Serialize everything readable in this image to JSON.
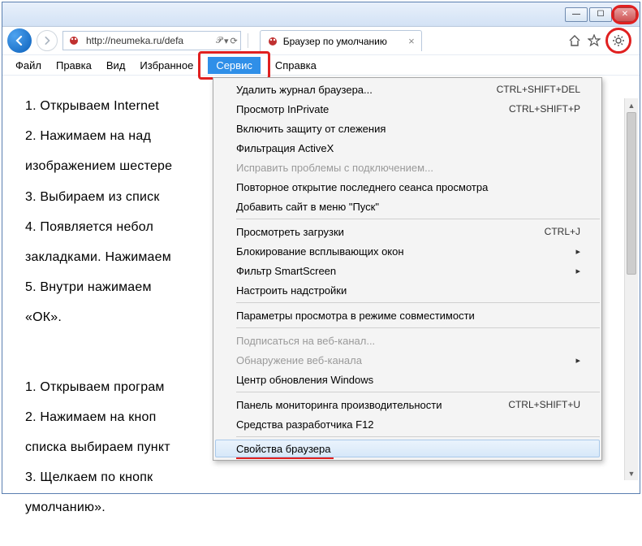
{
  "titlebar": {
    "minimize": "—",
    "maximize": "☐"
  },
  "nav": {
    "url": "http://neumeka.ru/defa",
    "search_hint": "𝒫",
    "refresh": "⟳"
  },
  "tab": {
    "title": "Браузер по умолчанию"
  },
  "menubar": {
    "file": "Файл",
    "edit": "Правка",
    "view": "Вид",
    "favorites": "Избранное",
    "tools": "Сервис",
    "help": "Справка"
  },
  "content": {
    "l1": "1.  Открываем Internet",
    "l2": "2.  Нажимаем  на  над",
    "l3": "изображением шестере",
    "l4": "3.  Выбираем из списк",
    "l5": "4.  Появляется  небол",
    "l6": "закладками. Нажимаем",
    "l7": "5.  Внутри  нажимаем",
    "l8": "«ОК».",
    "l9": "",
    "l10": "1.  Открываем програм",
    "l11": "2.  Нажимаем  на  кноп",
    "l12": "списка выбираем пункт",
    "l13": "3.  Щелкаем  по  кнопк",
    "l14": "умолчанию»."
  },
  "dropdown": {
    "items": [
      {
        "label": "Удалить журнал браузера...",
        "shortcut": "CTRL+SHIFT+DEL"
      },
      {
        "label": "Просмотр InPrivate",
        "shortcut": "CTRL+SHIFT+P"
      },
      {
        "label": "Включить защиту от слежения"
      },
      {
        "label": "Фильтрация ActiveX"
      },
      {
        "label": "Исправить проблемы с подключением...",
        "disabled": true
      },
      {
        "label": "Повторное открытие последнего сеанса просмотра"
      },
      {
        "label": "Добавить сайт в меню \"Пуск\""
      },
      {
        "sep": true
      },
      {
        "label": "Просмотреть загрузки",
        "shortcut": "CTRL+J"
      },
      {
        "label": "Блокирование всплывающих окон",
        "sub": true
      },
      {
        "label": "Фильтр SmartScreen",
        "sub": true
      },
      {
        "label": "Настроить надстройки"
      },
      {
        "sep": true
      },
      {
        "label": "Параметры просмотра в режиме совместимости"
      },
      {
        "sep": true
      },
      {
        "label": "Подписаться на веб-канал...",
        "disabled": true
      },
      {
        "label": "Обнаружение веб-канала",
        "disabled": true,
        "sub": true
      },
      {
        "label": "Центр обновления Windows"
      },
      {
        "sep": true
      },
      {
        "label": "Панель мониторинга производительности",
        "shortcut": "CTRL+SHIFT+U"
      },
      {
        "label": "Средства разработчика F12"
      },
      {
        "sep": true
      },
      {
        "label": "Свойства браузера",
        "hovered": true,
        "underlined": true
      }
    ]
  }
}
